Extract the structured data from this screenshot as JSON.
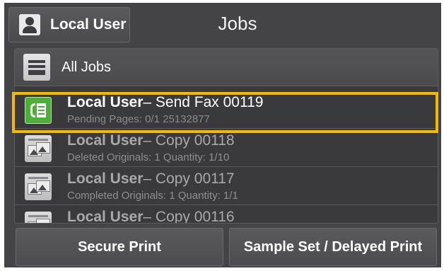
{
  "header": {
    "user_label": "Local User",
    "title": "Jobs"
  },
  "list": {
    "all_jobs_label": "All Jobs",
    "jobs": [
      {
        "owner": "Local User",
        "name": "– Send Fax 00119",
        "detail": "Pending Pages: 0/1 25132877",
        "icon": "fax-icon",
        "selected": true
      },
      {
        "owner": "Local User",
        "name": "– Copy 00118",
        "detail": "Deleted Originals: 1 Quantity: 1/10",
        "icon": "copy-icon"
      },
      {
        "owner": "Local User",
        "name": "– Copy 00117",
        "detail": "Completed Originals: 1 Quantity: 1/1",
        "icon": "copy-icon"
      },
      {
        "owner": "Local User",
        "name": "– Copy 00116",
        "detail": "",
        "icon": "copy-icon"
      }
    ]
  },
  "footer": {
    "secure_print_label": "Secure Print",
    "sample_set_label": "Sample Set / Delayed Print"
  },
  "colors": {
    "background": "#444446",
    "selection_border": "#f5b800",
    "fax_green": "#4fae3a"
  }
}
